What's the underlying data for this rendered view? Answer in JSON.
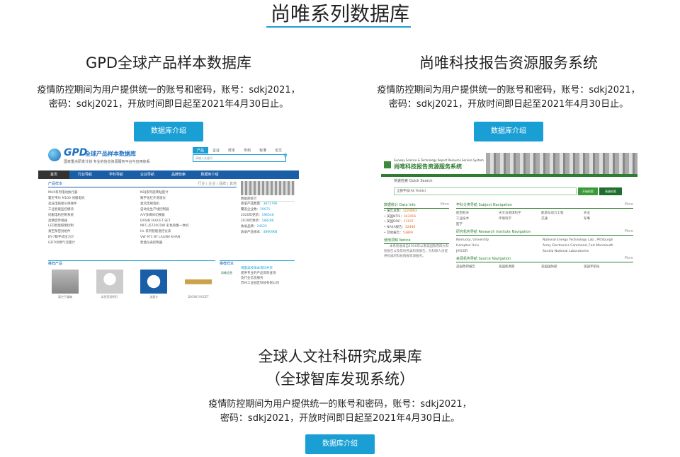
{
  "page": {
    "title": "尚唯系列数据库",
    "accent": "#1a9fd4"
  },
  "databases": [
    {
      "title": "GPD全球产品样本数据库",
      "desc_line1": "疫情防控期间为用户提供统一的账号和密码，账号：sdkj2021，",
      "desc_line2": "密码：sdkj2021，开放时间即日起至2021年4月30日止。",
      "button": "数据库介绍"
    },
    {
      "title": "尚唯科技报告资源服务系统",
      "desc_line1": "疫情防控期间为用户提供统一的账号和密码，账号：sdkj2021，",
      "desc_line2": "密码：sdkj2021，开放时间即日起至2021年4月30日止。",
      "button": "数据库介绍"
    },
    {
      "title_line1": "全球人文社科研究成果库",
      "title_line2": "（全球智库发现系统）",
      "desc_line1": "疫情防控期间为用户提供统一的账号和密码，账号：sdkj2021，",
      "desc_line2": "密码：sdkj2021，开放时间即日起至2021年4月30日止。",
      "button": "数据库介绍"
    }
  ],
  "gpd_shot": {
    "logo": "GPD",
    "subtitle": "全球产品样本数据库",
    "tagline": "国家重点研发计划·专业的信息资源服务平台与应用体系",
    "search_tabs": [
      "产品",
      "企业",
      "样本",
      "专利",
      "标准",
      "论文"
    ],
    "search_placeholder": "请输入关键词",
    "nav": [
      "首页",
      "行业导航",
      "学科导航",
      "企业导航",
      "品牌检索",
      "数据库介绍"
    ],
    "list_head": "产品样本",
    "list_links": "行业 | 企业 | 品牌 | 其他",
    "list_col1": [
      "MAX系列电动执行器",
      "霍尼韦尔 M100 伺服电机",
      "高压电缆接头绝缘件",
      "工业智能监控模块",
      "伺服电机控制系统",
      "高精度传感器",
      "LED智能照明控制",
      "真空泵密封组件",
      "BY-7数字式压力计",
      "GD700燃气流量计"
    ],
    "list_col2": [
      "NDJ系列旋转粘度计",
      "数字化红外测温仪",
      "直流无刷电机",
      "自动化生产线控制器",
      "A/V多媒体切换器",
      "DASIN FAUCET SET",
      "MFC-J5720CDW 彩色喷墨一体机",
      "HL 系列智能温控仪表",
      "VW 971 BY LALINA KHAN",
      "智能仪表控制器"
    ],
    "side_caption": "数据库统计",
    "stats": [
      [
        "收录产品数量：",
        "3872796"
      ],
      [
        "覆盖企业数：",
        "29071"
      ],
      [
        "2020年更新：",
        "196546"
      ],
      [
        "2019年更新：",
        "188286"
      ],
      [
        "收录品牌：",
        "24525"
      ],
      [
        "收录产品样本：",
        "4890968"
      ]
    ],
    "prod_head": "推荐产品",
    "prod_items": [
      "真空干燥箱",
      "实验室照明灯",
      "流量计",
      "DASIN FAUCET"
    ],
    "ad_head": "推荐样本",
    "ad_title": "海量高校样本资料共享",
    "ad_lines": [
      "提供专业的产品资料查询",
      "及行业信息服务"
    ],
    "ad_company": "苏州工业园区科技有限公司",
    "ad_logo": "尚唯信息"
  },
  "sw_shot": {
    "logo_en": "Sunway Science & Technology Report Resource Service System",
    "logo": "尚唯科技报告资源服务系统",
    "search_tabs": "快速检索  Quick Search",
    "search_value": "全部字段(All Fields)",
    "btn_search": "开始检索",
    "btn_adv": "高级检索",
    "left_head": "数据统计 Data Info",
    "left_items": [
      [
        "报告总数：",
        "1223663"
      ],
      [
        "美国NTIS：",
        "343416"
      ],
      [
        "美国DOE：",
        "17437"
      ],
      [
        "NASA报告：",
        "52446"
      ],
      [
        "其他报告：",
        "53849"
      ]
    ],
    "notice_head": "使用须知 Notice",
    "notice": "本系统收录自1950年以来美国政府四大科技报告以及其他各类科技报告，为科研人员提供权威的科技情报资源服务。",
    "right_head1": "学科分类导航 Subject Navigation",
    "subjects": [
      "航空航天",
      "天文与地球科学",
      "能源与动力工程",
      "农业",
      "工业技术",
      "环境科学",
      "交通",
      "军事",
      "医学"
    ],
    "right_head2": "研究机构导航 Research Institute Navigation",
    "institutes": [
      "Kentucky, University",
      "National Energy Technology Lab., Pittsburgh",
      "Hampton Univ",
      "Army Electronics Command, Fort Monmouth",
      "JAYCOR",
      "Sandia National Laboratories"
    ],
    "right_head3": "来源机构导航 Source Navigation",
    "sources": [
      "美国政府报告",
      "美国能源部",
      "美国国防部",
      "美国宇航局"
    ]
  }
}
